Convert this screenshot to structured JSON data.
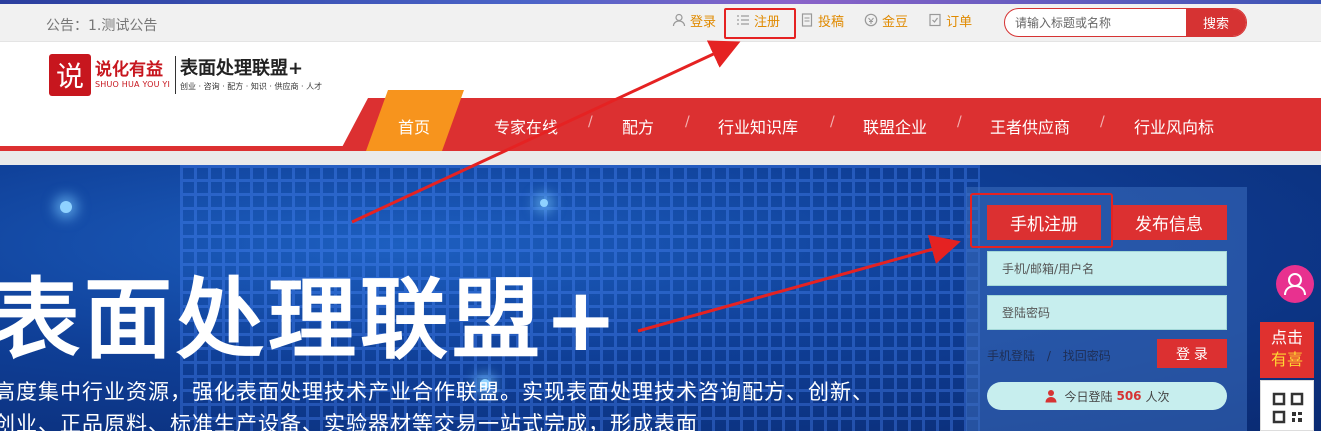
{
  "notice": "公告：1.测试公告",
  "toplinks": [
    {
      "label": "登录",
      "icon": "user-icon"
    },
    {
      "label": "注册",
      "icon": "list-icon"
    },
    {
      "label": "投稿",
      "icon": "document-icon"
    },
    {
      "label": "金豆",
      "icon": "coin-icon"
    },
    {
      "label": "订单",
      "icon": "checklist-icon"
    }
  ],
  "search": {
    "placeholder": "请输入标题或名称",
    "button": "搜索"
  },
  "logo": {
    "mark": "说",
    "cn": "说化有益",
    "en": "SHUO HUA YOU YI",
    "title": "表面处理联盟+",
    "subtitle": "创业 · 咨询 · 配方 · 知识 · 供应商 · 人才"
  },
  "nav": {
    "home": "首页",
    "items": [
      "专家在线",
      "配方",
      "行业知识库",
      "联盟企业",
      "王者供应商",
      "行业风向标"
    ]
  },
  "banner": {
    "title": "表面处理联盟+",
    "text": "高度集中行业资源，强化表面处理技术产业合作联盟。实现表面处理技术咨询配方、创新、创业、正品原料、标准生产设备、实验器材等交易一站式完成，形成表面"
  },
  "login": {
    "tab_register": "手机注册",
    "tab_publish": "发布信息",
    "username_placeholder": "手机/邮箱/用户名",
    "password_placeholder": "登陆密码",
    "phone_login": "手机登陆",
    "separator": "/",
    "forgot": "找回密码",
    "login_button": "登 录",
    "today_prefix": "今日登陆",
    "today_count": "506",
    "today_suffix": "人次"
  },
  "float": {
    "line1": "点击",
    "line2": "有喜"
  },
  "colors": {
    "brand_red": "#dc3031",
    "orange": "#f7941d",
    "link_orange": "#e08a00",
    "banner_blue": "#0f3f97"
  }
}
